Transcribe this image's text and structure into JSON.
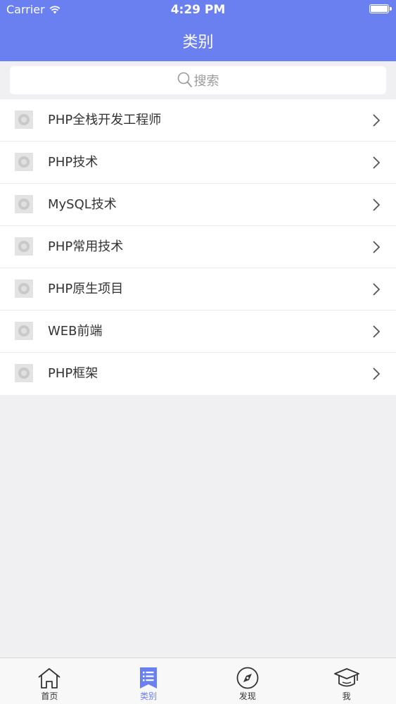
{
  "status_bar": {
    "carrier": "Carrier",
    "time": "4:29 PM"
  },
  "nav": {
    "title": "类别"
  },
  "search": {
    "placeholder": "搜索",
    "icon": "search-icon"
  },
  "categories": [
    {
      "label": "PHP全栈开发工程师"
    },
    {
      "label": "PHP技术"
    },
    {
      "label": "MySQL技术"
    },
    {
      "label": "PHP常用技术"
    },
    {
      "label": "PHP原生项目"
    },
    {
      "label": "WEB前端"
    },
    {
      "label": "PHP框架"
    }
  ],
  "tabbar": {
    "tabs": [
      {
        "label": "首页",
        "icon": "home-icon",
        "active": false
      },
      {
        "label": "类别",
        "icon": "list-icon",
        "active": true
      },
      {
        "label": "发现",
        "icon": "compass-icon",
        "active": false
      },
      {
        "label": "我",
        "icon": "graduation-cap-icon",
        "active": false
      }
    ]
  },
  "colors": {
    "accent": "#6a7ff0",
    "background": "#f0f0f2"
  }
}
